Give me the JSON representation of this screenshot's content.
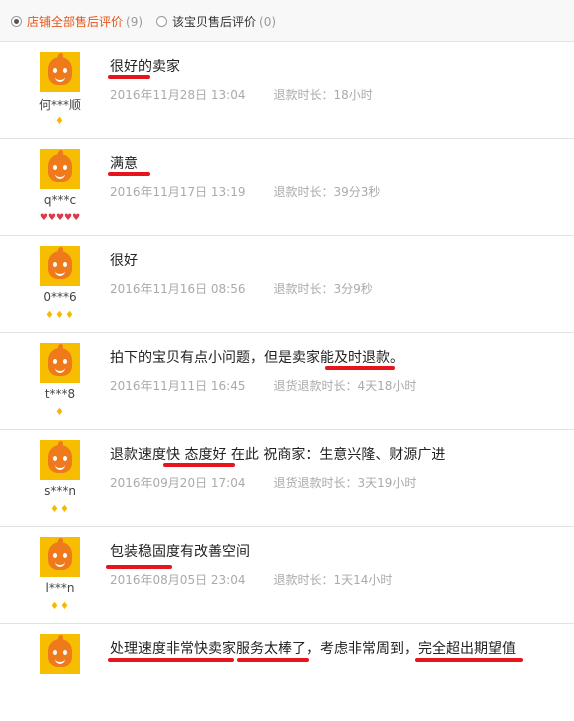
{
  "filter": {
    "options": [
      {
        "label": "店铺全部售后评价",
        "count": "(9)",
        "selected": true
      },
      {
        "label": "该宝贝售后评价",
        "count": "(0)",
        "selected": false
      }
    ]
  },
  "reviews": [
    {
      "user": "何***顺",
      "badge": "♦",
      "badge_type": "gold",
      "content": "很好的卖家",
      "time": "2016年11月28日 13:04",
      "refund_label": "退款时长：",
      "refund_value": "18小时"
    },
    {
      "user": "q***c",
      "badge": "♥♥♥♥♥",
      "badge_type": "red",
      "content": "满意",
      "time": "2016年11月17日 13:19",
      "refund_label": "退款时长：",
      "refund_value": "39分3秒"
    },
    {
      "user": "0***6",
      "badge": "♦♦♦",
      "badge_type": "gold",
      "content": "很好",
      "time": "2016年11月16日 08:56",
      "refund_label": "退款时长：",
      "refund_value": "3分9秒"
    },
    {
      "user": "t***8",
      "badge": "♦",
      "badge_type": "gold",
      "content": "拍下的宝贝有点小问题，但是卖家能及时退款。",
      "time": "2016年11月11日 16:45",
      "refund_label": "退货退款时长：",
      "refund_value": "4天18小时"
    },
    {
      "user": "s***n",
      "badge": "♦♦",
      "badge_type": "gold",
      "content": "退款速度快 态度好 在此 祝商家：生意兴隆、财源广进",
      "time": "2016年09月20日 17:04",
      "refund_label": "退货退款时长：",
      "refund_value": "3天19小时"
    },
    {
      "user": "l***n",
      "badge": "♦♦",
      "badge_type": "gold",
      "content": "包装稳固度有改善空间",
      "time": "2016年08月05日 23:04",
      "refund_label": "退款时长：",
      "refund_value": "1天14小时"
    },
    {
      "user": "",
      "badge": "",
      "badge_type": "gold",
      "content": "处理速度非常快卖家服务太棒了，考虑非常周到，完全超出期望值",
      "time": "",
      "refund_label": "",
      "refund_value": ""
    }
  ]
}
